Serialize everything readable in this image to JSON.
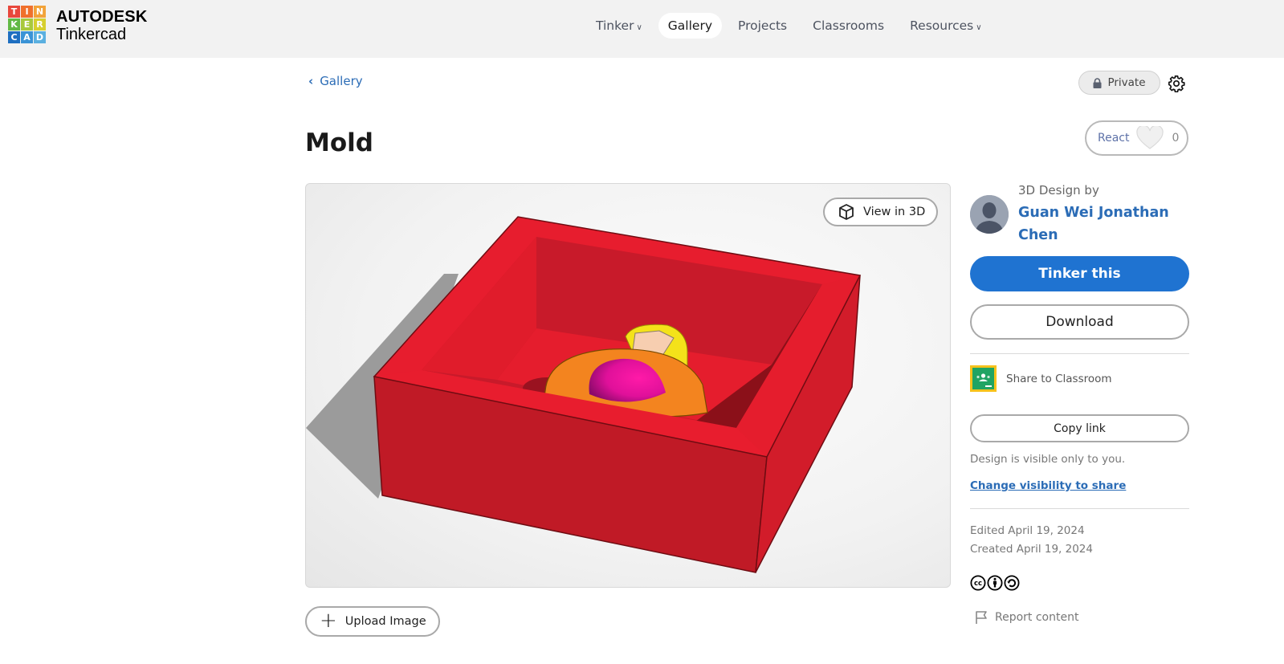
{
  "brand": {
    "logo_letters": [
      "T",
      "I",
      "N",
      "K",
      "E",
      "R",
      "C",
      "A",
      "D"
    ],
    "logo_colors": [
      "#e8473c",
      "#f0702c",
      "#f2a33a",
      "#62b945",
      "#a8c93c",
      "#d6d12e",
      "#1e6fc1",
      "#3a93d6",
      "#5bb0e0"
    ],
    "company": "AUTODESK",
    "product": "Tinkercad"
  },
  "nav": {
    "items": [
      {
        "label": "Tinker",
        "dropdown": true,
        "active": false
      },
      {
        "label": "Gallery",
        "dropdown": false,
        "active": true
      },
      {
        "label": "Projects",
        "dropdown": false,
        "active": false
      },
      {
        "label": "Classrooms",
        "dropdown": false,
        "active": false
      },
      {
        "label": "Resources",
        "dropdown": true,
        "active": false
      }
    ]
  },
  "breadcrumb": {
    "back_label": "Gallery",
    "icon": "chevron-left-icon"
  },
  "design": {
    "title": "Mold",
    "privacy_label": "Private",
    "privacy_icon": "lock-icon",
    "settings_icon": "gear-icon",
    "react_label": "React",
    "react_count": "0",
    "react_icon": "heart-icon"
  },
  "viewer": {
    "view3d_label": "View in 3D",
    "view3d_icon": "cube-icon",
    "upload_label": "Upload Image",
    "upload_icon": "plus-icon",
    "colors": {
      "box_front": "#c01a26",
      "box_top": "#e71d2e",
      "box_right": "#d21c2a",
      "inner_back": "#c81a2a",
      "inner_right": "#8b1019",
      "ring": "#f3841f",
      "sphere": "#ec0f9c",
      "yellow": "#f4e21a",
      "shadow": "#9b9b9b"
    }
  },
  "sidebar": {
    "by_label": "3D Design by",
    "author": "Guan Wei Jonathan Chen",
    "tinker_label": "Tinker this",
    "download_label": "Download",
    "classroom_label": "Share to Classroom",
    "copy_label": "Copy link",
    "visibility_note": "Design is visible only to you.",
    "visibility_link": "Change visibility to share",
    "edited": "Edited April 19, 2024",
    "created": "Created April 19, 2024",
    "license_icons": [
      "cc-icon",
      "by-icon",
      "sa-icon"
    ],
    "report_label": "Report content",
    "accent": "#1f73d1",
    "link_color": "#2b6cb6"
  }
}
